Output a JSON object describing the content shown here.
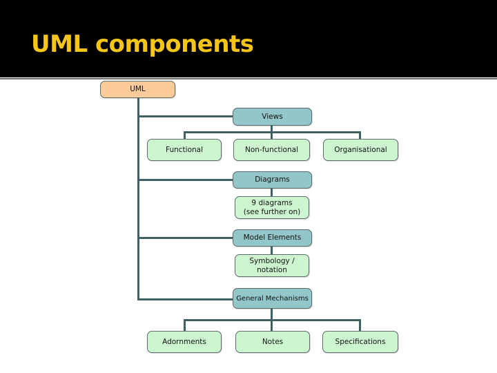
{
  "slide": {
    "title": "UML components"
  },
  "colors": {
    "header_bg": "#000000",
    "title_text": "#f5c518",
    "root_box": "#fbcb9a",
    "category_box": "#93c6c8",
    "leaf_box": "#cdf6d0",
    "connector": "#3f5f63"
  },
  "diagram": {
    "root": "UML",
    "views": {
      "label": "Views",
      "children": [
        "Functional",
        "Non-functional",
        "Organisational"
      ]
    },
    "diagrams": {
      "label": "Diagrams",
      "child_line1": "9 diagrams",
      "child_line2": "(see further on)"
    },
    "model_elements": {
      "label": "Model Elements",
      "child_line1": "Symbology /",
      "child_line2": "notation"
    },
    "general_mechanisms": {
      "label": "General Mechanisms",
      "children": [
        "Adornments",
        "Notes",
        "Specifications"
      ]
    }
  }
}
